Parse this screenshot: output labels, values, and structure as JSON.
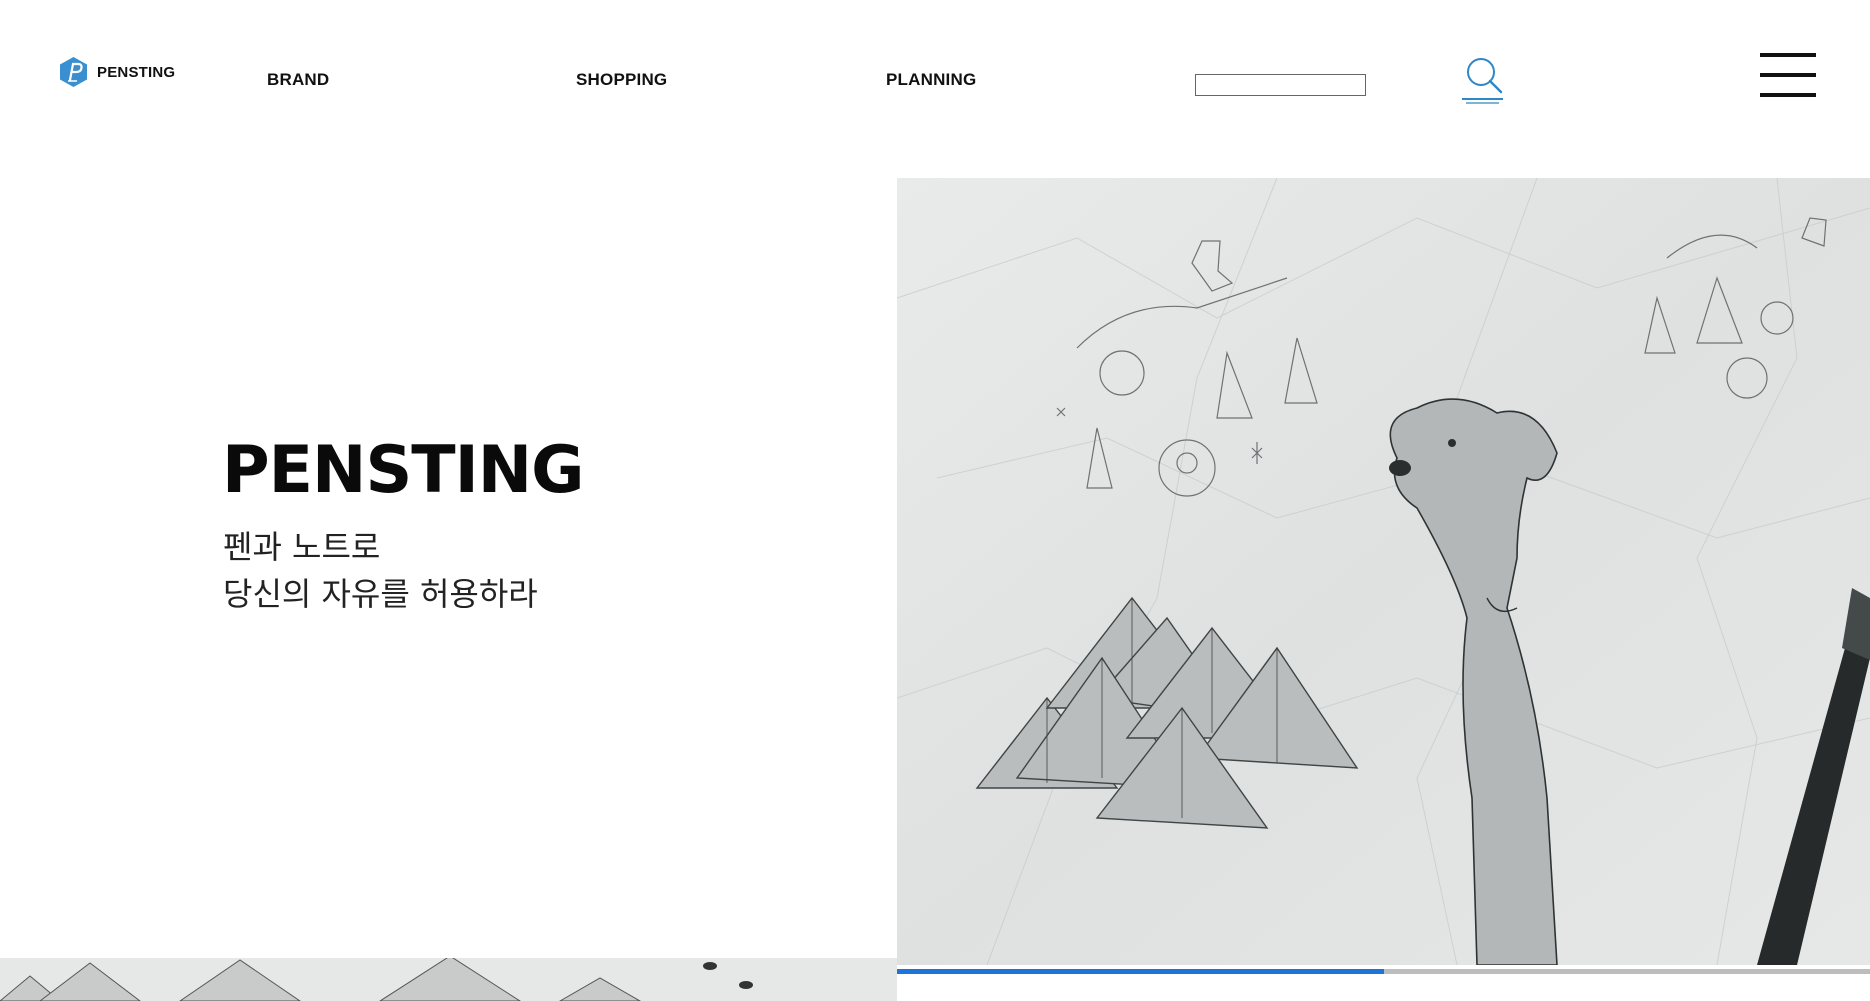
{
  "header": {
    "logo_text": "PENSTING",
    "nav": [
      {
        "label": "BRAND"
      },
      {
        "label": "SHOPPING"
      },
      {
        "label": "PLANNING"
      }
    ],
    "search": {
      "value": "",
      "placeholder": ""
    },
    "colors": {
      "logo_blue": "#3a8fd0",
      "search_icon": "#2f86c8"
    },
    "icons": [
      "logo-p-icon",
      "search-icon",
      "hamburger-menu-icon"
    ]
  },
  "hero": {
    "title": "PENSTING",
    "subtitle_line1": "펜과 노트로",
    "subtitle_line2": "당신의 자유를 허용하라",
    "image_description_icon": "sketch-dog-mountains-illustration"
  },
  "slider": {
    "progress": 0.5,
    "colors": {
      "fill": "#1f74d9",
      "track": "#bdbdbd"
    }
  }
}
